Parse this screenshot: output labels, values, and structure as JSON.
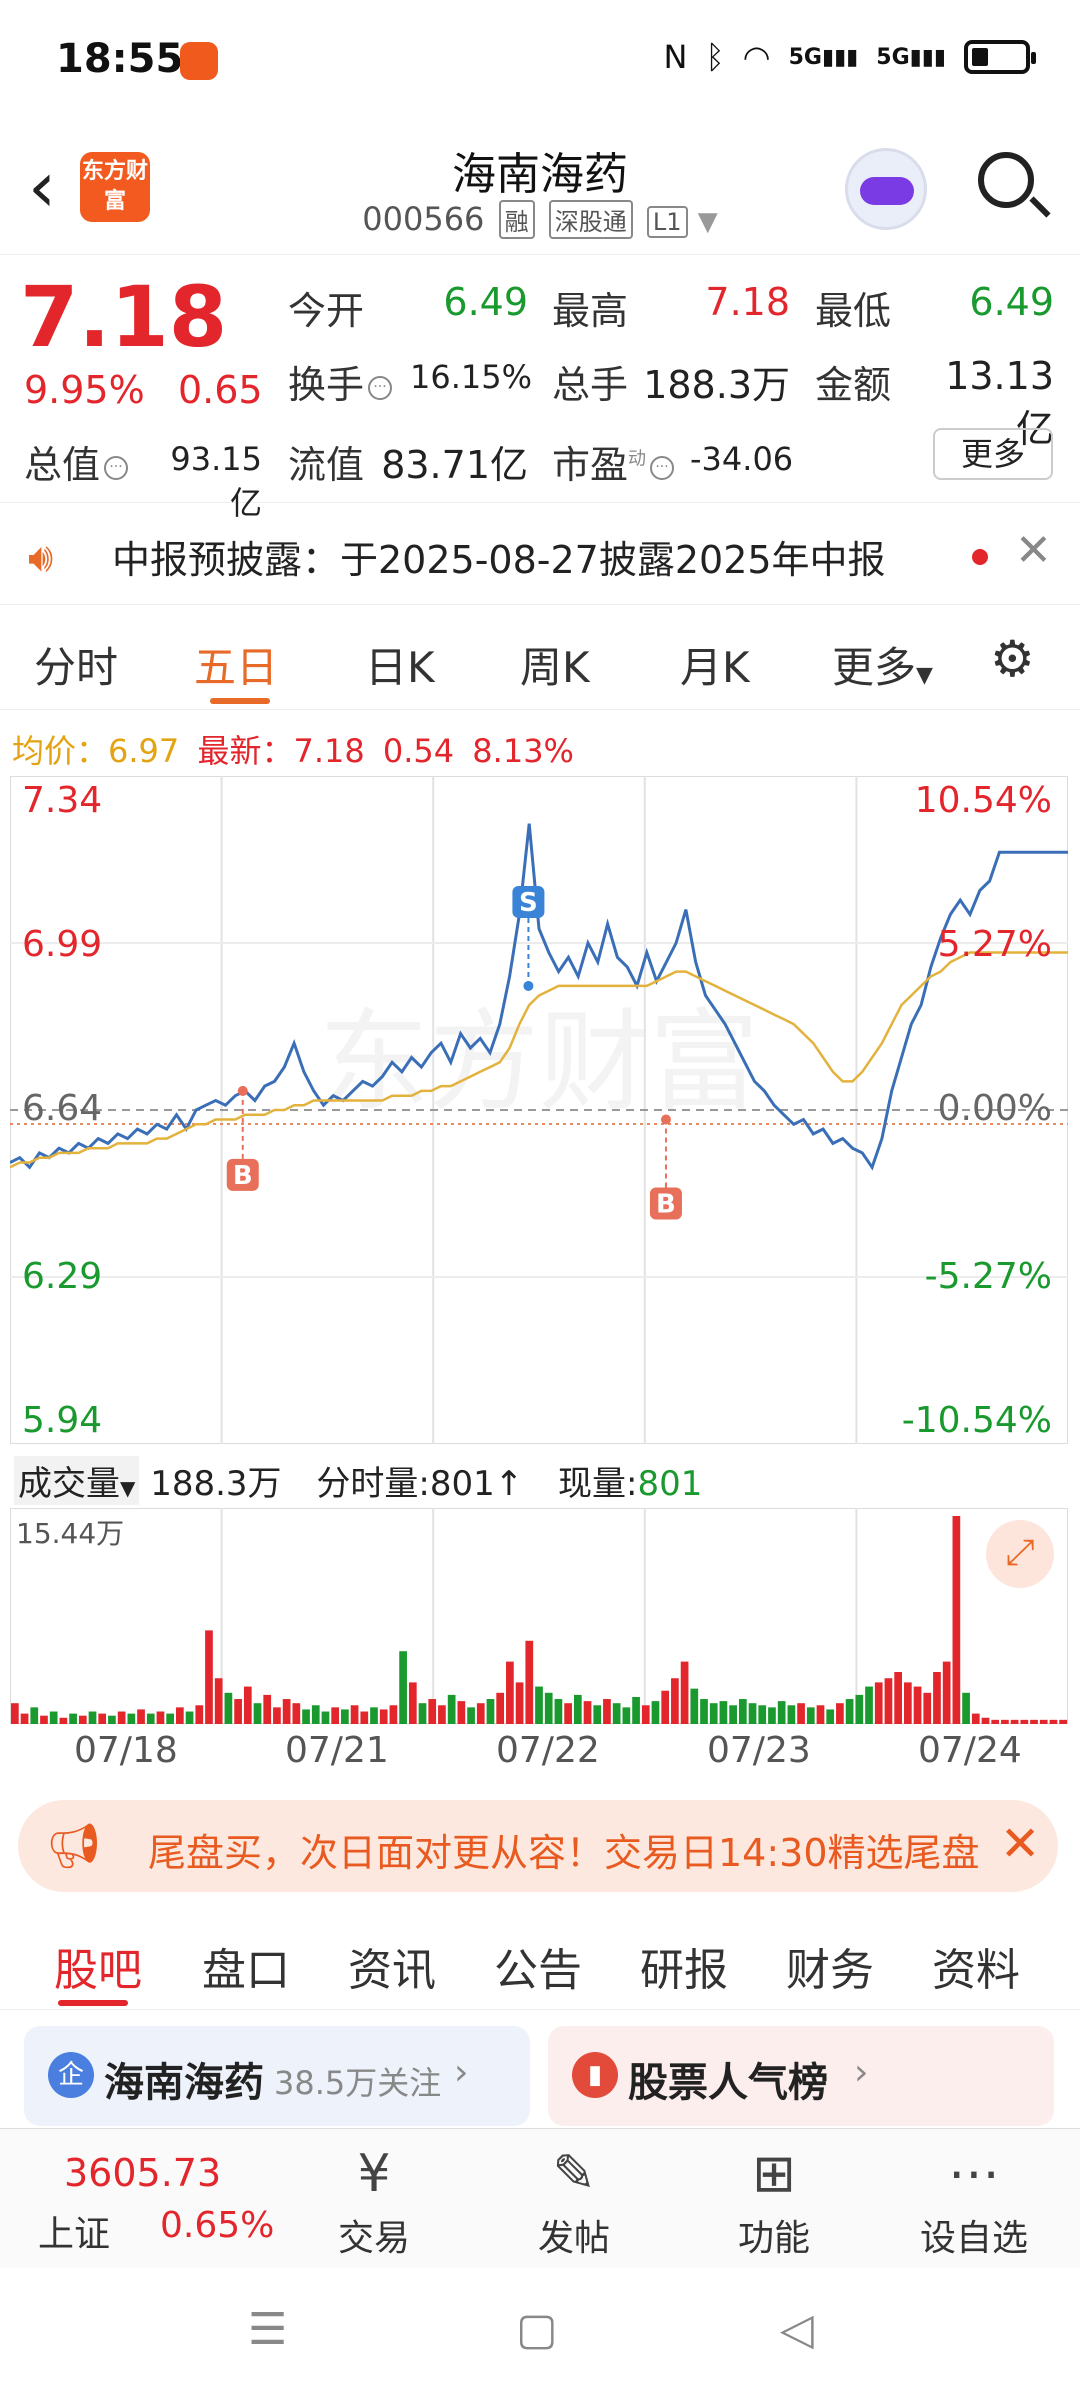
{
  "status_bar": {
    "time": "18:55",
    "icons": [
      "nfc-icon",
      "bluetooth-icon",
      "wifi-icon",
      "5g-signal-icon",
      "5g-signal-icon",
      "battery-icon"
    ],
    "net1": "5G",
    "net2": "5G"
  },
  "header": {
    "logo_text": "东方财富",
    "stock_name": "海南海药",
    "stock_code": "000566",
    "tags": [
      "融",
      "深股通",
      "L1"
    ]
  },
  "quote": {
    "price": "7.18",
    "change_pct": "9.95%",
    "change_amt": "0.65",
    "fields": [
      {
        "label": "今开",
        "value": "6.49",
        "color": "green"
      },
      {
        "label": "最高",
        "value": "7.18",
        "color": "red"
      },
      {
        "label": "最低",
        "value": "6.49",
        "color": "green"
      },
      {
        "label": "换手",
        "value": "16.15%",
        "color": "black"
      },
      {
        "label": "总手",
        "value": "188.3万",
        "color": "black"
      },
      {
        "label": "金额",
        "value": "13.13亿",
        "color": "black"
      },
      {
        "label": "总值",
        "value": "93.15亿",
        "color": "black"
      },
      {
        "label": "流值",
        "value": "83.71亿",
        "color": "black"
      },
      {
        "label": "市盈",
        "value": "-34.06",
        "color": "black"
      }
    ],
    "pe_superscript": "动",
    "more_label": "更多"
  },
  "notice": {
    "text": "中报预披露：于2025-08-27披露2025年中报"
  },
  "chart_tabs": [
    "分时",
    "五日",
    "日K",
    "周K",
    "月K",
    "更多"
  ],
  "chart_tabs_active": "五日",
  "chart_info": {
    "avg_label": "均价：",
    "avg_value": "6.97",
    "latest_label": "最新：",
    "latest_value": "7.18",
    "latest_change": "0.54",
    "latest_pct": "8.13%"
  },
  "watermark": "东方财富",
  "chart_data": {
    "type": "line",
    "title": "",
    "x": [
      "07/18",
      "07/21",
      "07/22",
      "07/23",
      "07/24"
    ],
    "ylim": [
      5.94,
      7.34
    ],
    "y_ticks_left": [
      "7.34",
      "6.99",
      "6.64",
      "6.29",
      "5.94"
    ],
    "y_ticks_right": [
      "10.54%",
      "5.27%",
      "0.00%",
      "-5.27%",
      "-10.54%"
    ],
    "reference_price": 6.64,
    "series": [
      {
        "values": [
          6.53,
          6.54,
          6.52,
          6.55,
          6.54,
          6.56,
          6.55,
          6.57,
          6.56,
          6.58,
          6.57,
          6.59,
          6.58,
          6.6,
          6.59,
          6.61,
          6.6,
          6.63,
          6.6,
          6.64,
          6.65,
          6.66,
          6.65,
          6.67,
          6.68,
          6.66,
          6.69,
          6.7,
          6.73,
          6.78,
          6.72,
          6.68,
          6.65,
          6.67,
          6.66,
          6.68,
          6.7,
          6.69,
          6.71,
          6.74,
          6.72,
          6.75,
          6.73,
          6.76,
          6.78,
          6.74,
          6.8,
          6.77,
          6.79,
          6.76,
          6.82,
          6.92,
          7.05,
          7.24,
          7.02,
          6.97,
          6.93,
          6.96,
          6.92,
          6.99,
          6.95,
          7.03,
          6.96,
          6.94,
          6.9,
          6.97,
          6.91,
          6.95,
          6.99,
          7.06,
          6.95,
          6.88,
          6.85,
          6.82,
          6.78,
          6.74,
          6.7,
          6.68,
          6.65,
          6.63,
          6.61,
          6.62,
          6.59,
          6.6,
          6.57,
          6.58,
          6.56,
          6.55,
          6.52,
          6.58,
          6.68,
          6.75,
          6.82,
          6.86,
          6.94,
          7.0,
          7.05,
          7.08,
          7.05,
          7.1,
          7.12,
          7.18,
          7.18,
          7.18,
          7.18,
          7.18,
          7.18,
          7.18,
          7.18
        ]
      },
      {
        "values": [
          6.52,
          6.53,
          6.53,
          6.54,
          6.54,
          6.55,
          6.55,
          6.55,
          6.56,
          6.56,
          6.56,
          6.57,
          6.57,
          6.57,
          6.57,
          6.58,
          6.58,
          6.59,
          6.6,
          6.61,
          6.61,
          6.62,
          6.62,
          6.62,
          6.63,
          6.63,
          6.63,
          6.64,
          6.64,
          6.65,
          6.65,
          6.66,
          6.66,
          6.66,
          6.66,
          6.66,
          6.66,
          6.66,
          6.66,
          6.67,
          6.67,
          6.67,
          6.68,
          6.68,
          6.69,
          6.69,
          6.7,
          6.71,
          6.72,
          6.73,
          6.74,
          6.77,
          6.82,
          6.86,
          6.88,
          6.89,
          6.9,
          6.9,
          6.9,
          6.9,
          6.9,
          6.9,
          6.9,
          6.9,
          6.9,
          6.9,
          6.91,
          6.92,
          6.93,
          6.93,
          6.92,
          6.91,
          6.9,
          6.89,
          6.88,
          6.87,
          6.86,
          6.85,
          6.84,
          6.83,
          6.82,
          6.8,
          6.78,
          6.75,
          6.72,
          6.7,
          6.7,
          6.72,
          6.75,
          6.78,
          6.82,
          6.86,
          6.88,
          6.9,
          6.92,
          6.93,
          6.95,
          6.96,
          6.97,
          6.97,
          6.97,
          6.97,
          6.97,
          6.97,
          6.97,
          6.97,
          6.97,
          6.97,
          6.97
        ]
      }
    ],
    "trade_markers": [
      {
        "label": "B",
        "day": "07/21",
        "price": 6.68
      },
      {
        "label": "S",
        "day": "07/22",
        "price": 6.9
      },
      {
        "label": "B",
        "day": "07/23",
        "price": 6.62
      }
    ]
  },
  "volume": {
    "label": "成交量",
    "total": "188.3万",
    "tick_label": "分时量:",
    "tick_value": "801↑",
    "now_label": "现量:",
    "now_value": "801",
    "max_label": "15.44万",
    "bars": [
      0.1,
      0.05,
      0.08,
      0.04,
      0.06,
      0.03,
      0.05,
      0.04,
      0.06,
      0.05,
      0.04,
      0.06,
      0.05,
      0.07,
      0.05,
      0.06,
      0.05,
      0.08,
      0.06,
      0.09,
      0.45,
      0.22,
      0.15,
      0.12,
      0.18,
      0.1,
      0.14,
      0.08,
      0.12,
      0.1,
      0.07,
      0.09,
      0.06,
      0.08,
      0.07,
      0.09,
      0.06,
      0.08,
      0.07,
      0.09,
      0.35,
      0.2,
      0.1,
      0.12,
      0.09,
      0.14,
      0.11,
      0.08,
      0.1,
      0.12,
      0.15,
      0.3,
      0.2,
      0.4,
      0.18,
      0.15,
      0.12,
      0.1,
      0.14,
      0.11,
      0.09,
      0.12,
      0.1,
      0.08,
      0.13,
      0.09,
      0.11,
      0.16,
      0.22,
      0.3,
      0.17,
      0.12,
      0.1,
      0.11,
      0.09,
      0.12,
      0.1,
      0.09,
      0.08,
      0.11,
      0.09,
      0.1,
      0.08,
      0.09,
      0.07,
      0.1,
      0.12,
      0.14,
      0.18,
      0.2,
      0.22,
      0.25,
      0.2,
      0.18,
      0.15,
      0.25,
      0.3,
      1.0,
      0.15,
      0.05,
      0.03,
      0.02,
      0.02,
      0.02,
      0.02,
      0.02,
      0.02,
      0.02,
      0.02
    ]
  },
  "promo": {
    "text": "尾盘买，次日面对更从容！交易日14:30精选尾盘"
  },
  "content_tabs": [
    "股吧",
    "盘口",
    "资讯",
    "公告",
    "研报",
    "财务",
    "资料"
  ],
  "content_tabs_active": "股吧",
  "cards": {
    "a_icon": "企",
    "a_title": "海南海药",
    "a_sub": "38.5万关注",
    "b_title": "股票人气榜"
  },
  "bottom_nav": {
    "index_value": "3605.73",
    "index_name": "上证",
    "index_change": "0.65%",
    "items": [
      "交易",
      "发帖",
      "功能",
      "设自选"
    ]
  },
  "colors": {
    "up": "#e2262c",
    "down": "#1a9a2e",
    "price_line": "#3a6fb8",
    "avg_line": "#e3b23c",
    "accent": "#e86a28"
  }
}
